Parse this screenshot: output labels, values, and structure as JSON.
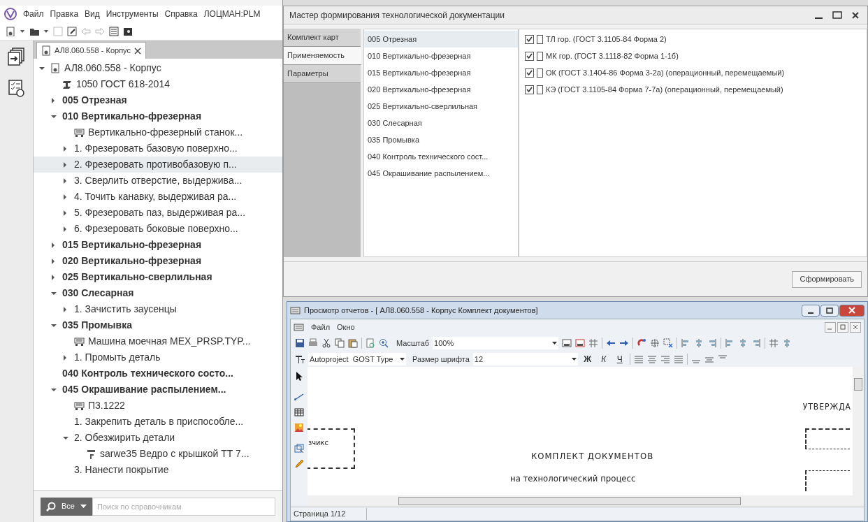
{
  "app": {
    "menu": [
      "Файл",
      "Правка",
      "Вид",
      "Инструменты",
      "Справка",
      "ЛОЦМАН:PLM"
    ],
    "document_tab": {
      "label": "АЛ8.060.558 - Корпус"
    }
  },
  "tree": [
    {
      "label": "АЛ8.060.558 - Корпус",
      "kind": "document",
      "expanded": true,
      "selected": false,
      "children": [
        {
          "label": "1050 ГОСТ 618-2014",
          "kind": "material",
          "selected": false
        },
        {
          "label": "005 Отрезная",
          "kind": "operation",
          "expanded": false,
          "selected": false
        },
        {
          "label": "010 Вертикально-фрезерная",
          "kind": "operation",
          "expanded": true,
          "selected": false,
          "children": [
            {
              "label": "Вертикально-фрезерный станок...",
              "kind": "equipment",
              "selected": false
            },
            {
              "label": "1. Фрезеровать базовую поверхно...",
              "kind": "step",
              "expanded": false,
              "selected": false
            },
            {
              "label": "2. Фрезеровать противобазовую п...",
              "kind": "step",
              "expanded": false,
              "selected": true
            },
            {
              "label": "3. Сверлить отверстие, выдержива...",
              "kind": "step",
              "expanded": false,
              "selected": false
            },
            {
              "label": "4. Точить канавку, выдерживая ра...",
              "kind": "step",
              "expanded": false,
              "selected": false
            },
            {
              "label": "5. Фрезеровать паз, выдерживая ра...",
              "kind": "step",
              "expanded": false,
              "selected": false
            },
            {
              "label": "6. Фрезеровать боковые поверхно...",
              "kind": "step",
              "expanded": false,
              "selected": false
            }
          ]
        },
        {
          "label": "015 Вертикально-фрезерная",
          "kind": "operation",
          "expanded": false,
          "selected": false
        },
        {
          "label": "020 Вертикально-фрезерная",
          "kind": "operation",
          "expanded": false,
          "selected": false
        },
        {
          "label": "025 Вертикально-сверлильная",
          "kind": "operation",
          "expanded": false,
          "selected": false
        },
        {
          "label": "030 Слесарная",
          "kind": "operation",
          "expanded": true,
          "selected": false,
          "children": [
            {
              "label": "1. Зачистить заусенцы",
              "kind": "step",
              "expanded": false,
              "selected": false
            }
          ]
        },
        {
          "label": "035 Промывка",
          "kind": "operation",
          "expanded": true,
          "selected": false,
          "children": [
            {
              "label": "Машина моечная MEX_PRSP.TYP...",
              "kind": "equipment",
              "selected": false
            },
            {
              "label": "1. Промыть деталь",
              "kind": "step",
              "expanded": false,
              "selected": false
            }
          ]
        },
        {
          "label": "040 Контроль технического состо...",
          "kind": "operation",
          "selected": false
        },
        {
          "label": "045 Окрашивание распылением...",
          "kind": "operation",
          "expanded": true,
          "selected": false,
          "children": [
            {
              "label": "П3.1222",
              "kind": "equipment",
              "selected": false
            },
            {
              "label": "1. Закрепить деталь в приспособле...",
              "kind": "step",
              "selected": false
            },
            {
              "label": "2. Обезжирить детали",
              "kind": "step",
              "expanded": true,
              "selected": false,
              "children": [
                {
                  "label": "sarwe35 Ведро с крышкой ТТ 7...",
                  "kind": "tool",
                  "selected": false
                }
              ]
            },
            {
              "label": "3. Нанести покрытие",
              "kind": "step",
              "selected": false
            }
          ]
        }
      ]
    }
  ],
  "search": {
    "scope": "Все",
    "placeholder": "Поиск по справочникам"
  },
  "wizard": {
    "title": "Мастер формирования технологической документации",
    "tabs": [
      {
        "label": "Комплект карт",
        "selected": false
      },
      {
        "label": "Применяемость",
        "selected": true
      },
      {
        "label": "Параметры",
        "selected": false
      }
    ],
    "operations": [
      {
        "label": "005 Отрезная",
        "selected": true
      },
      {
        "label": "010 Вертикально-фрезерная",
        "selected": false
      },
      {
        "label": "015 Вертикально-фрезерная",
        "selected": false
      },
      {
        "label": "020 Вертикально-фрезерная",
        "selected": false
      },
      {
        "label": "025 Вертикально-сверлильная",
        "selected": false
      },
      {
        "label": "030 Слесарная",
        "selected": false
      },
      {
        "label": "035 Промывка",
        "selected": false
      },
      {
        "label": "040 Контроль технического сост...",
        "selected": false
      },
      {
        "label": "045 Окрашивание распылением...",
        "selected": false
      }
    ],
    "documents": [
      {
        "label": "ТЛ гор. (ГОСТ 3.1105-84 Форма 2)",
        "checked": true
      },
      {
        "label": "МК гор. (ГОСТ 3.1118-82 Форма 1-1б)",
        "checked": true
      },
      {
        "label": "ОК (ГОСТ 3.1404-86 Форма 3-2а) (операционный, перемещаемый)",
        "checked": true
      },
      {
        "label": "КЭ (ГОСТ 3.1105-84 Форма 7-7а) (операционный, перемещаемый)",
        "checked": true
      }
    ],
    "button": "Сформировать"
  },
  "report_viewer": {
    "title": "Просмотр отчетов - [ АЛ8.060.558 - Корпус Комплект документов]",
    "menu": [
      "Файл",
      "Окно"
    ],
    "zoom_label": "Масштаб",
    "zoom_value": "100%",
    "font_value": "Autoproject  GOST Type",
    "font_size_label": "Размер шрифта",
    "font_size_value": "12",
    "format_buttons": [
      "Ж",
      "К",
      "Ч"
    ],
    "document": {
      "approval": "УТВЕРЖДА",
      "side_label": "зчикс",
      "heading": "КОМПЛЕКТ ДОКУМЕНТОВ",
      "subheading": "на технологический процесс"
    },
    "status": "Страница 1/12"
  }
}
